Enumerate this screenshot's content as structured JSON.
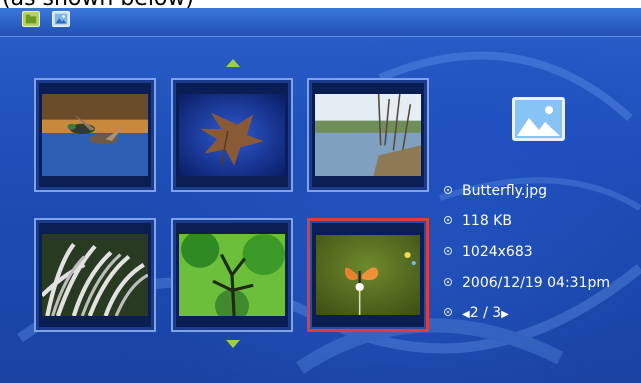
{
  "caption": "(as shown below)",
  "toolbar": {
    "icons": [
      "folder-icon",
      "photo-icon"
    ]
  },
  "navigation": {
    "up_icon": "up-arrow-icon",
    "down_icon": "down-arrow-icon"
  },
  "thumbnails": [
    {
      "subject": "ducks",
      "selected": false
    },
    {
      "subject": "leaf",
      "selected": false
    },
    {
      "subject": "river",
      "selected": false
    },
    {
      "subject": "grass",
      "selected": false
    },
    {
      "subject": "tree",
      "selected": false
    },
    {
      "subject": "butterfly",
      "selected": true
    }
  ],
  "file_info": {
    "icon": "image-icon",
    "filename": "Butterfly.jpg",
    "size": "118 KB",
    "resolution": "1024x683",
    "datetime": "2006/12/19 04:31pm",
    "page_current": "2",
    "page_sep": "/",
    "page_total": "3",
    "prev_glyph": "◀",
    "next_glyph": "▶"
  },
  "colors": {
    "background": "#1f4fb9",
    "selection": "#e23b3b",
    "arrow": "#9bd13f",
    "text": "#ffffff"
  }
}
